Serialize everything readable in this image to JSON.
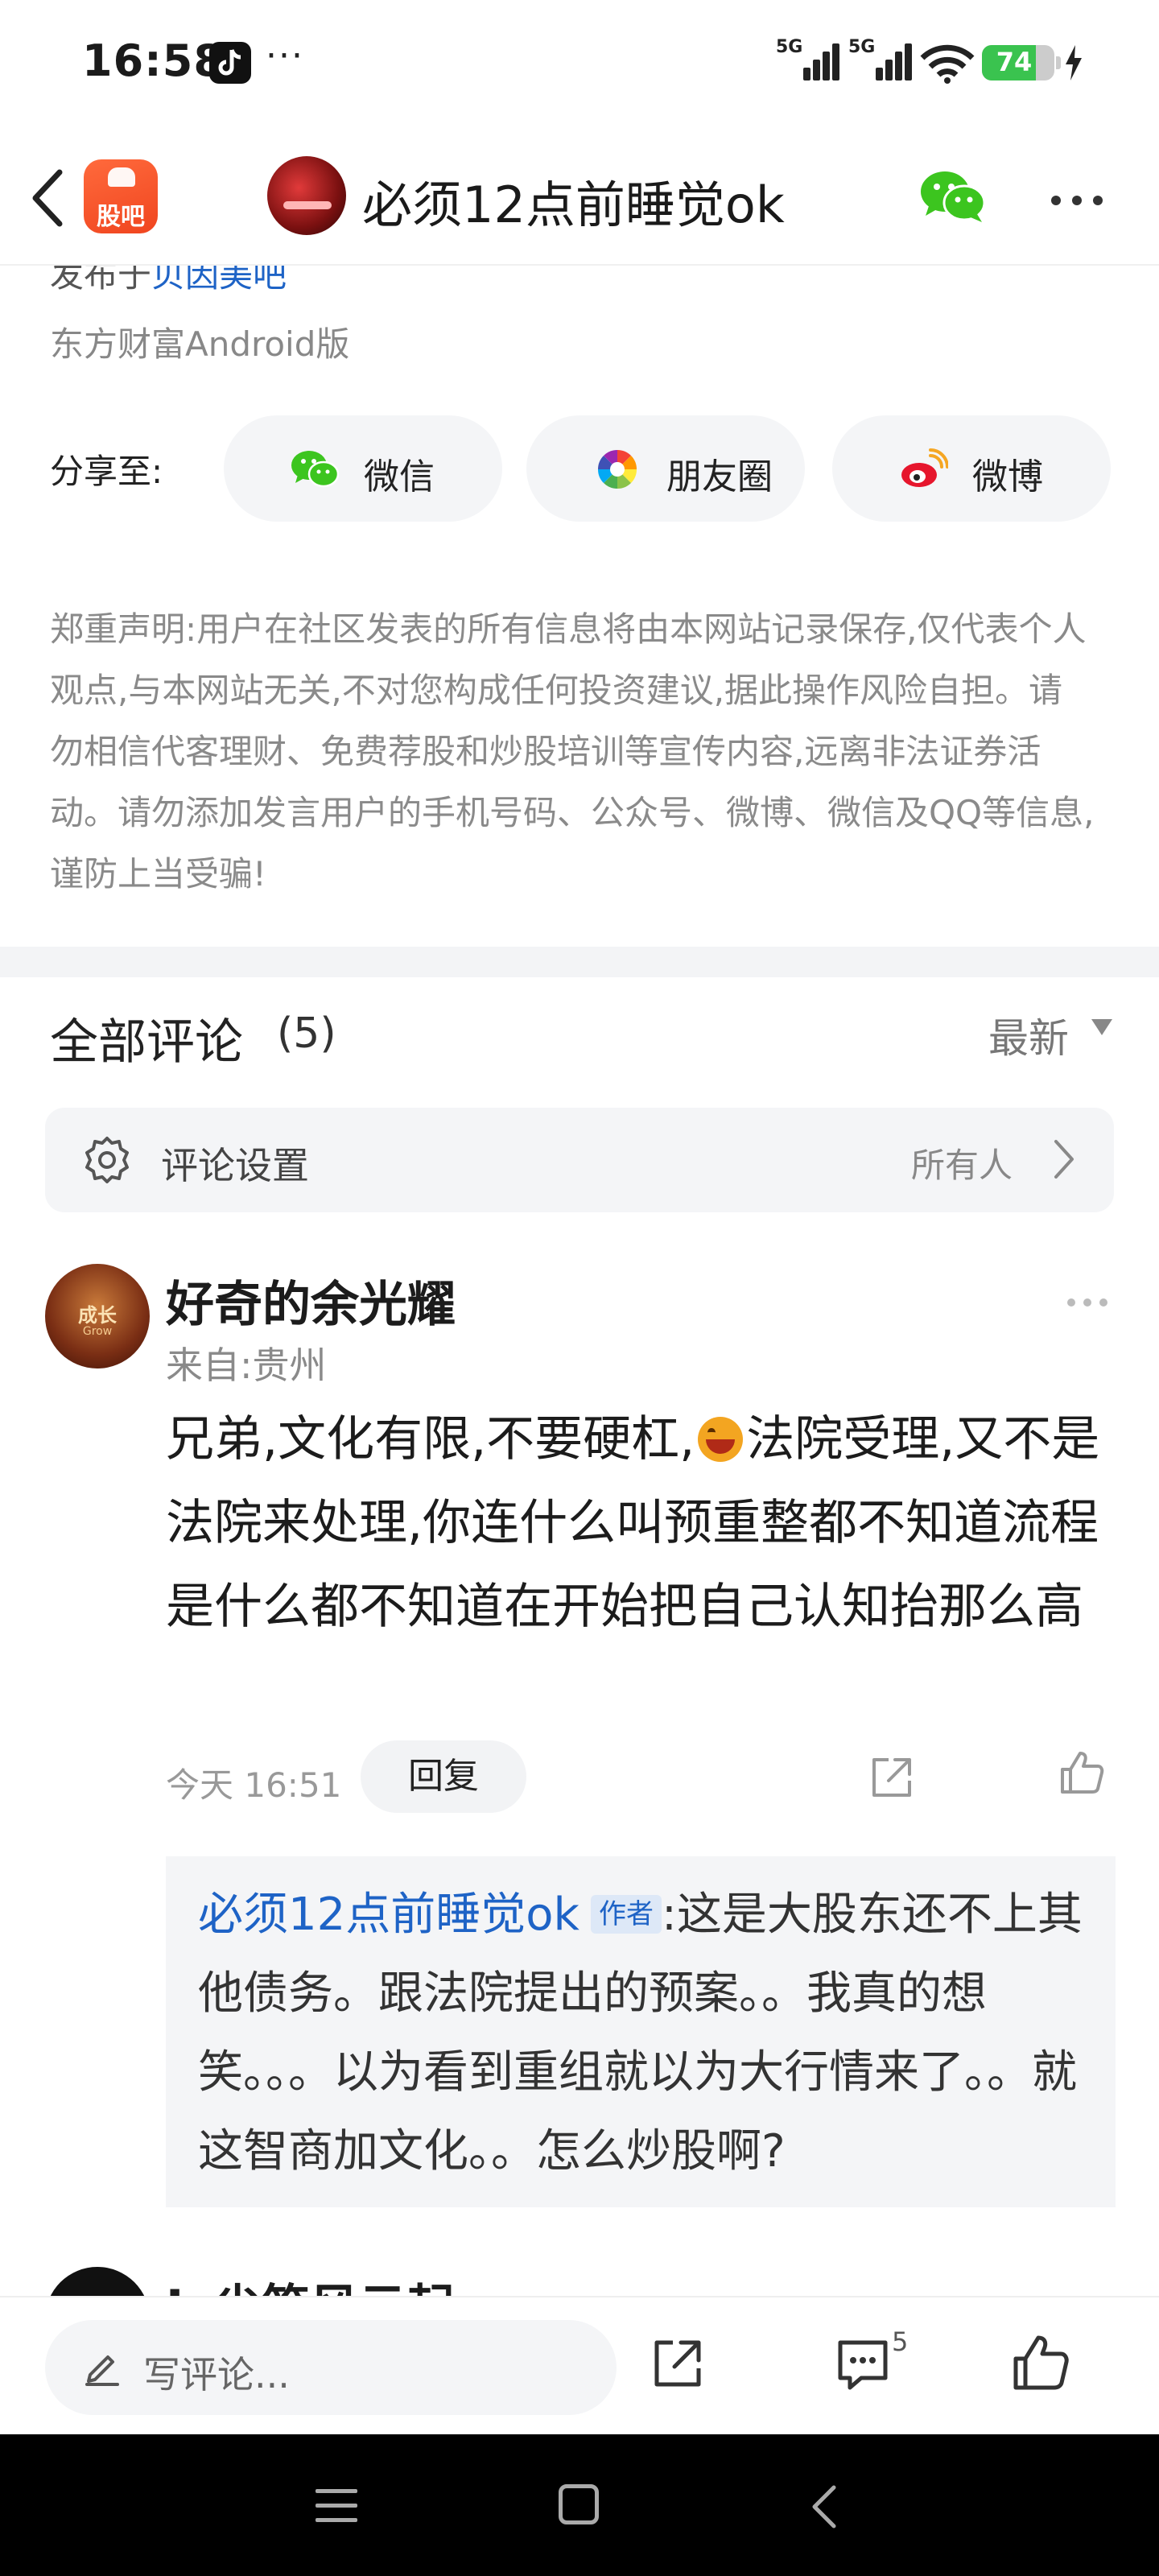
{
  "status_bar": {
    "time": "16:58",
    "dots": "···",
    "network_1": "5G",
    "network_2": "5G",
    "battery": "74"
  },
  "nav": {
    "app_logo_text": "股吧",
    "title": "必须12点前睡觉ok"
  },
  "post": {
    "posted_prefix": "发布于",
    "posted_forum": "贝因美吧",
    "source": "东方财富Android版"
  },
  "share": {
    "label": "分享至:",
    "options": [
      {
        "label": "微信",
        "icon": "wechat-icon"
      },
      {
        "label": "朋友圈",
        "icon": "moments-icon"
      },
      {
        "label": "微博",
        "icon": "weibo-icon"
      }
    ]
  },
  "disclaimer": "郑重声明:用户在社区发表的所有信息将由本网站记录保存,仅代表个人观点,与本网站无关,不对您构成任何投资建议,据此操作风险自担。请勿相信代客理财、免费荐股和炒股培训等宣传内容,远离非法证券活动。请勿添加发言用户的手机号码、公众号、微博、微信及QQ等信息,谨防上当受骗!",
  "comments": {
    "title": "全部评论",
    "count": "(5)",
    "sort": "最新",
    "settings_label": "评论设置",
    "settings_value": "所有人",
    "items": [
      {
        "author": "好奇的余光耀",
        "avatar_text": "成长",
        "avatar_sub": "Grow",
        "location": "来自:贵州",
        "text_before_emoji": "兄弟,文化有限,不要硬杠,",
        "text_after_emoji": "法院受理,又不是法院来处理,你连什么叫预重整都不知道流程是什么都不知道在开始把自己认知抬那么高",
        "time": "今天 16:51",
        "reply_label": "回复",
        "reply": {
          "author": "必须12点前睡觉ok",
          "tag": "作者",
          "text": ":这是大股东还不上其他债务。跟法院提出的预案。。我真的想笑。。。以为看到重组就以为大行情来了。。就这智商加文化。。怎么炒股啊?"
        }
      }
    ],
    "next_author_partial": "L 尘笔风云起"
  },
  "toolbar": {
    "placeholder": "写评论...",
    "comment_count": "5"
  },
  "colors": {
    "link_blue": "#1e63c6",
    "brand_orange": "#f0451f",
    "battery_green": "#3ac34f"
  }
}
